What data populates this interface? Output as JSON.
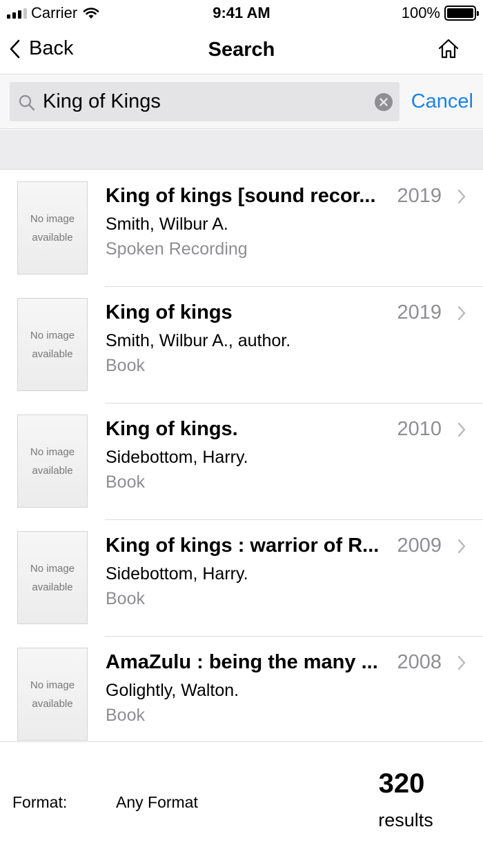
{
  "status_bar": {
    "carrier": "Carrier",
    "time": "9:41 AM",
    "battery": "100%"
  },
  "nav": {
    "back_label": "Back",
    "title": "Search",
    "home_icon": "home-icon"
  },
  "search": {
    "value": "King of Kings",
    "cancel_label": "Cancel"
  },
  "results": [
    {
      "thumb_line1": "No image",
      "thumb_line2": "available",
      "title": "King of kings [sound recor...",
      "year": "2019",
      "author": "Smith, Wilbur A.",
      "format": "Spoken Recording"
    },
    {
      "thumb_line1": "No image",
      "thumb_line2": "available",
      "title": "King of kings",
      "year": "2019",
      "author": "Smith, Wilbur A., author.",
      "format": "Book"
    },
    {
      "thumb_line1": "No image",
      "thumb_line2": "available",
      "title": "King of kings.",
      "year": "2010",
      "author": "Sidebottom, Harry.",
      "format": "Book"
    },
    {
      "thumb_line1": "No image",
      "thumb_line2": "available",
      "title": "King of kings : warrior of R...",
      "year": "2009",
      "author": "Sidebottom, Harry.",
      "format": "Book"
    },
    {
      "thumb_line1": "No image",
      "thumb_line2": "available",
      "title": "AmaZulu : being the many ...",
      "year": "2008",
      "author": "Golightly, Walton.",
      "format": "Book"
    }
  ],
  "footer": {
    "format_label": "Format:",
    "format_value": "Any Format",
    "results_count": "320",
    "results_label": "results"
  },
  "colors": {
    "accent": "#1a82e6",
    "secondary_text": "#8e8e93"
  }
}
